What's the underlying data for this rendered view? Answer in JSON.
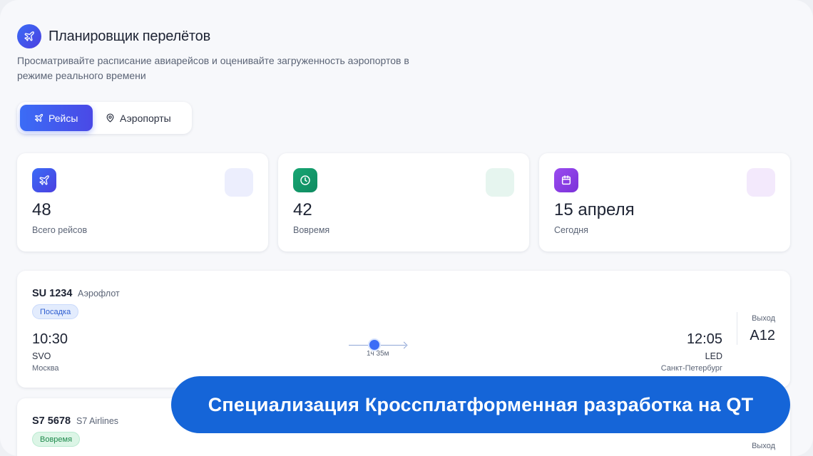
{
  "header": {
    "title": "Планировщик перелётов",
    "subtitle": "Просматривайте расписание авиарейсов и оценивайте загруженность аэропортов в режиме реального времени",
    "logo_icon": "plane-icon"
  },
  "tabs": [
    {
      "label": "Рейсы",
      "icon": "plane-icon",
      "active": true
    },
    {
      "label": "Аэропорты",
      "icon": "map-pin-icon",
      "active": false
    }
  ],
  "stats": [
    {
      "value": "48",
      "label": "Всего рейсов",
      "icon": "plane-icon",
      "color": "#4a55e8",
      "deco": "#eceefd"
    },
    {
      "value": "42",
      "label": "Вовремя",
      "icon": "clock-icon",
      "color": "#129a6b",
      "deco": "#e6f5ef"
    },
    {
      "value": "15 апреля",
      "label": "Сегодня",
      "icon": "calendar-icon",
      "color": "#8a3fe0",
      "deco": "#f3e9fc"
    }
  ],
  "flights": [
    {
      "code": "SU 1234",
      "airline": "Аэрофлот",
      "status": "Посадка",
      "status_color": "blue",
      "dep_time": "10:30",
      "dep_code": "SVO",
      "dep_city": "Москва",
      "duration": "1ч 35м",
      "arr_time": "12:05",
      "arr_code": "LED",
      "arr_city": "Санкт-Петербург",
      "gate_label": "Выход",
      "gate": "A12"
    },
    {
      "code": "S7 5678",
      "airline": "S7 Airlines",
      "status": "Вовремя",
      "status_color": "green",
      "gate_label": "Выход"
    }
  ],
  "banner": {
    "text": "Специализация Кроссплатформенная разработка на QT"
  }
}
